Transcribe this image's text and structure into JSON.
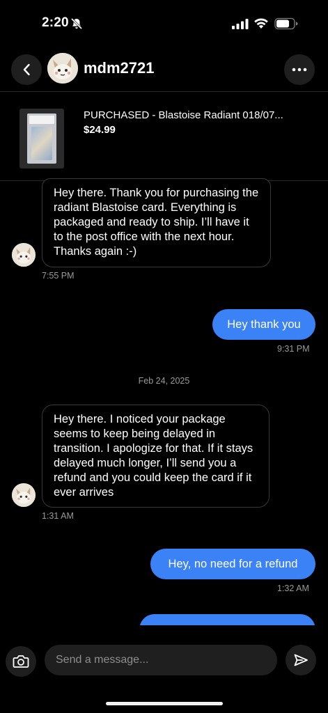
{
  "status_bar": {
    "time": "2:20"
  },
  "header": {
    "username": "mdm2721"
  },
  "product": {
    "title": "PURCHASED - Blastoise Radiant 018/07...",
    "price": "$24.99"
  },
  "messages": [
    {
      "direction": "incoming",
      "text": "Hey there. Thank you for purchasing the radiant Blastoise card. Everything is packaged and ready to ship. I’ll have it to the post office with the next hour. Thanks again :-)",
      "time": "7:55 PM"
    },
    {
      "direction": "outgoing",
      "text": "Hey thank you",
      "time": "9:31 PM"
    },
    {
      "direction": "incoming",
      "text": "Hey there. I noticed your package seems to keep being delayed in transition. I apologize for that. If it stays delayed much longer, I’ll send you a refund and you could keep the card if it ever arrives",
      "time": "1:31 AM"
    },
    {
      "direction": "outgoing",
      "text": "Hey, no need for a refund",
      "time": "1:32 AM"
    },
    {
      "direction": "outgoing",
      "text": "",
      "time": ""
    }
  ],
  "date_separator": "Feb 24, 2025",
  "composer": {
    "placeholder": "Send a message..."
  },
  "colors": {
    "background": "#000000",
    "outgoing_bubble": "#3b82f6",
    "incoming_border": "#3a3a3a",
    "button_bg": "#1f1f1f"
  },
  "icons": [
    "silent-bell-icon",
    "signal-icon",
    "wifi-icon",
    "battery-icon",
    "back-arrow-icon",
    "more-dots-icon",
    "camera-icon",
    "send-icon"
  ]
}
